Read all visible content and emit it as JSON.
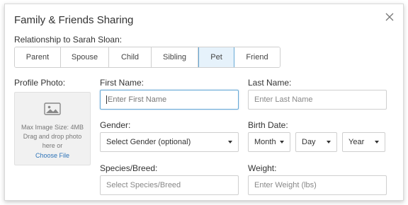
{
  "dialog": {
    "title": "Family & Friends Sharing",
    "close_icon": "close-icon"
  },
  "relationship": {
    "label": "Relationship to Sarah Sloan:",
    "options": [
      "Parent",
      "Spouse",
      "Child",
      "Sibling",
      "Pet",
      "Friend"
    ],
    "selected": "Pet"
  },
  "photo": {
    "label": "Profile Photo:",
    "icon": "image-icon",
    "max_size": "Max Image Size: 4MB",
    "drag_text": "Drag and drop photo here or",
    "choose_link": "Choose File"
  },
  "first_name": {
    "label": "First Name:",
    "placeholder": "Enter First Name"
  },
  "last_name": {
    "label": "Last Name:",
    "placeholder": "Enter Last Name"
  },
  "gender": {
    "label": "Gender:",
    "value": "Select Gender (optional)"
  },
  "birth_date": {
    "label": "Birth Date:",
    "month": "Month",
    "day": "Day",
    "year": "Year"
  },
  "species": {
    "label": "Species/Breed:",
    "placeholder": "Select Species/Breed"
  },
  "weight": {
    "label": "Weight:",
    "placeholder": "Enter Weight (lbs)"
  },
  "colors": {
    "accent": "#67a9d6",
    "link": "#2d73b8",
    "active_bg": "#e6f2fb"
  }
}
